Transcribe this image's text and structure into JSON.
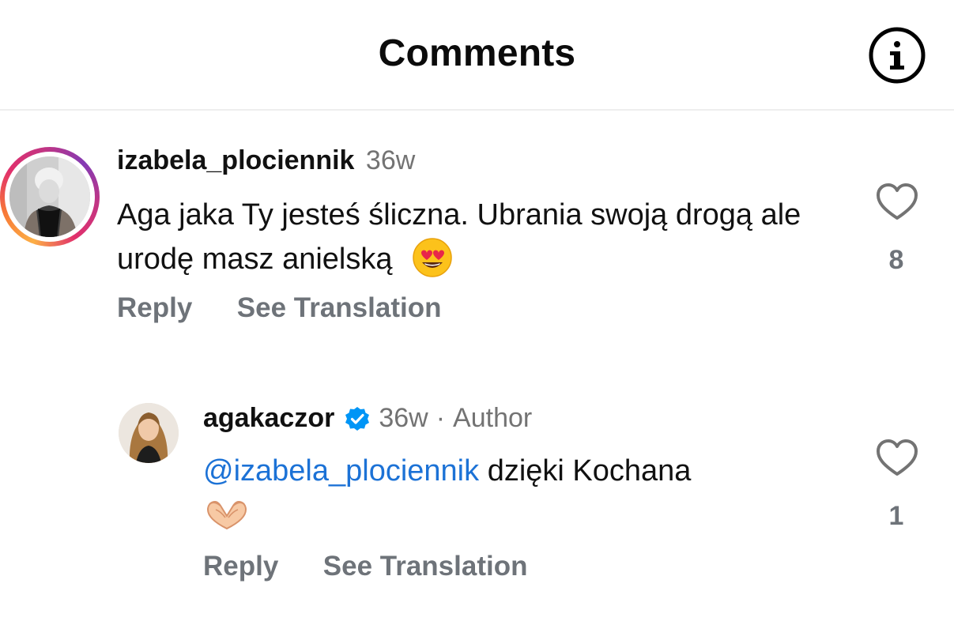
{
  "header": {
    "title": "Comments",
    "info_icon": "info-circle-icon"
  },
  "comments": [
    {
      "username": "izabela_plociennik",
      "time": "36w",
      "text": "Aga jaka Ty jesteś śliczna. Ubrania swoją drogą ale urodę masz anielską",
      "emoji": "heart-eyes-emoji",
      "actions": {
        "reply": "Reply",
        "translate": "See Translation"
      },
      "likes": "8",
      "has_story_ring": true
    }
  ],
  "reply": {
    "username": "agakaczor",
    "verified": true,
    "time": "36w",
    "separator": "·",
    "author_label": "Author",
    "mention": "@izabela_plociennik",
    "text": "dzięki Kochana",
    "emoji": "heart-hands-emoji",
    "actions": {
      "reply": "Reply",
      "translate": "See Translation"
    },
    "likes": "1"
  },
  "colors": {
    "accent_link": "#1c72d6",
    "muted": "#737373",
    "verified": "#0095f6"
  }
}
